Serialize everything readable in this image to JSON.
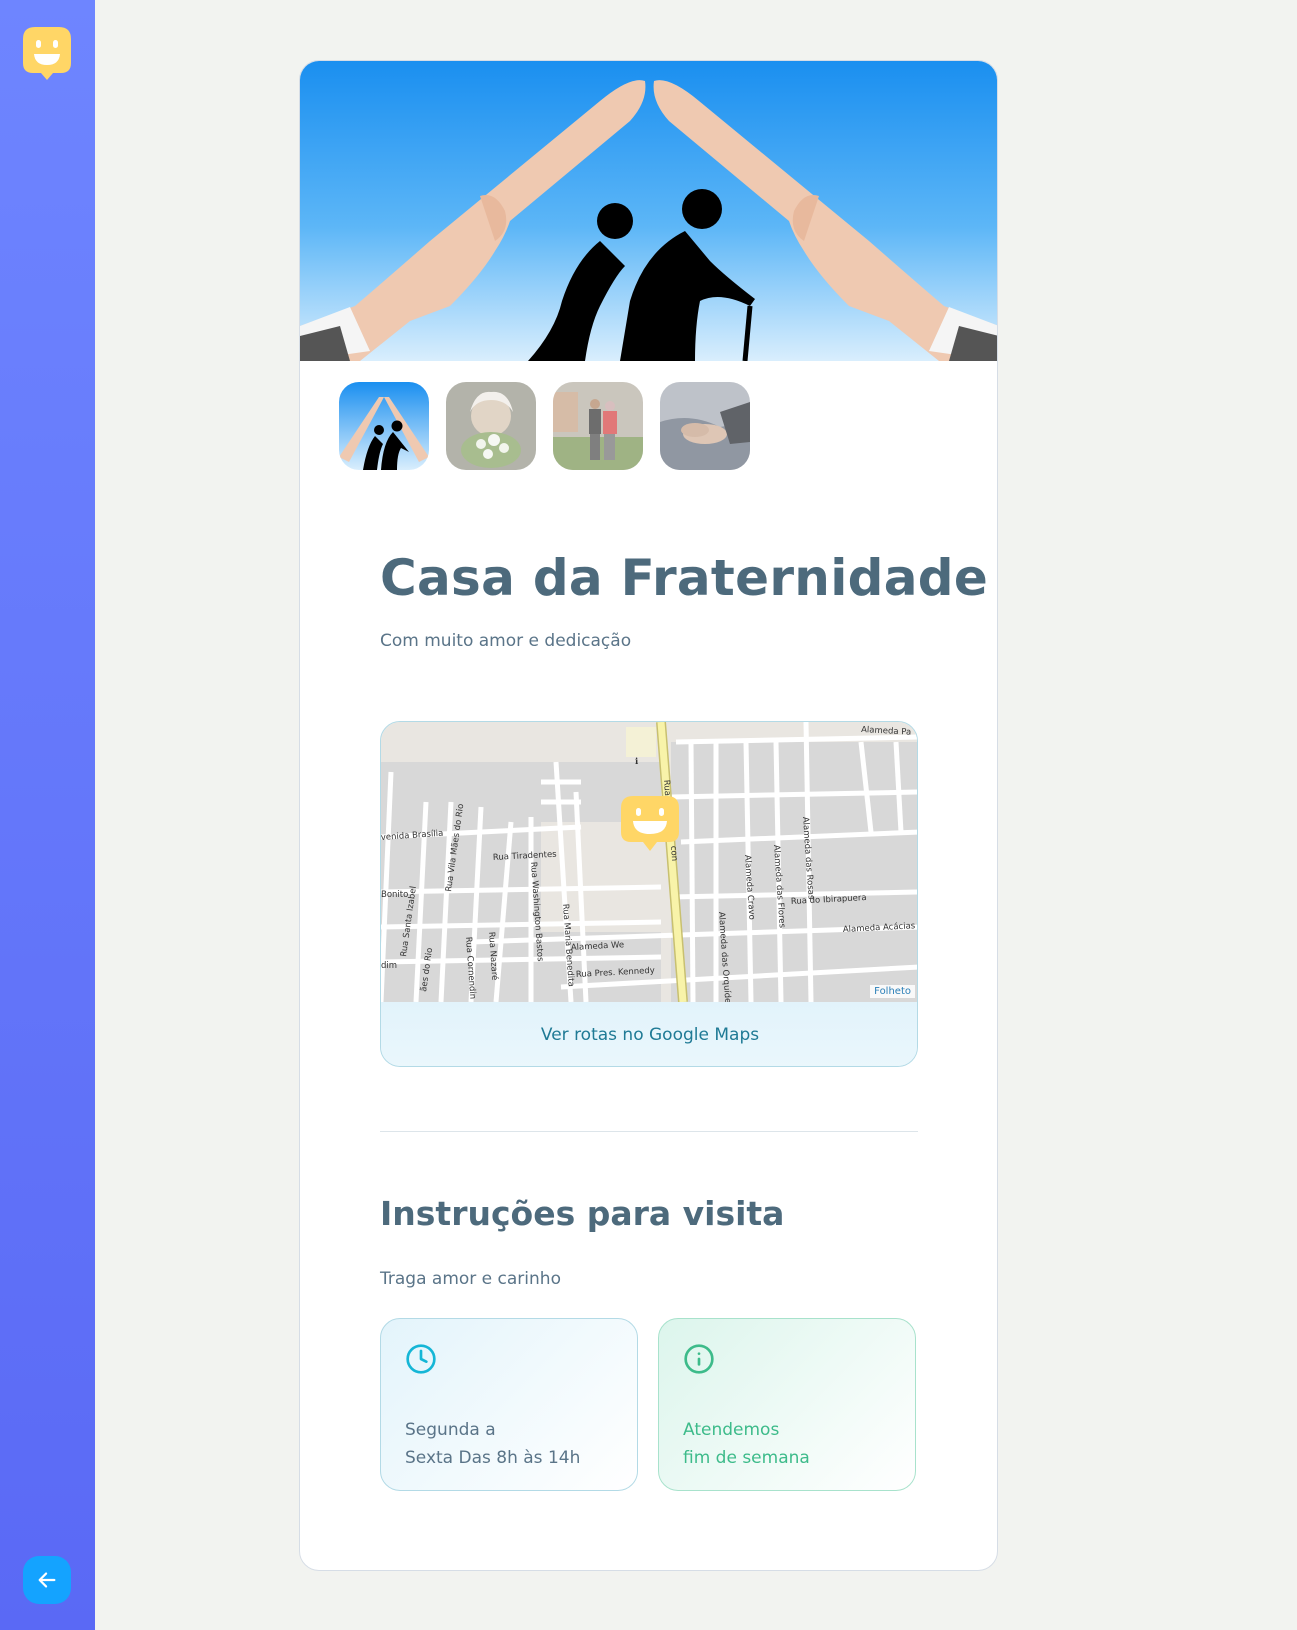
{
  "place": {
    "title": "Casa da Fraternidade",
    "subtitle": "Com muito amor e dedicação"
  },
  "gallery": {
    "thumbnails": [
      "hands-house-elderly",
      "elderly-woman-flowers",
      "elderly-couple-walking",
      "holding-hands"
    ],
    "active_index": 0
  },
  "map": {
    "link_label": "Ver rotas no Google Maps",
    "attribution": "Folheto",
    "street_labels": [
      "Alameda Pa",
      "venida Brasília",
      "Rua Vila Mães do Rio",
      "Rua Tiradentes",
      "Bonito",
      "Rua Santa Izabel",
      "Rua Washington Bastos",
      "Rua Maria Benedita",
      "Alameda We",
      "Rua Pres. Kennedy",
      "dim",
      "ães do Rio",
      "Rua Cornendin",
      "Rua Nazaré",
      "Alameda Cravo",
      "Alameda das Flores",
      "Alameda das Rosas",
      "Rua do Ibirapuera",
      "Alameda Acácias",
      "Alameda das Orquíde",
      "Rua",
      "con"
    ]
  },
  "instructions": {
    "heading": "Instruções para visita",
    "subtitle": "Traga amor e carinho",
    "hours": {
      "line1": "Segunda a",
      "line2": "Sexta Das 8h às 14h",
      "icon": "clock-icon"
    },
    "weekend": {
      "line1": "Atendemos",
      "line2": "fim de semana",
      "icon": "info-icon"
    }
  },
  "colors": {
    "sidebar_top": "#6e85ff",
    "sidebar_bottom": "#5a69f5",
    "logo_yellow": "#ffd666",
    "back_button": "#14a3ff",
    "title_text": "#4d6a7c",
    "green_text": "#3dbb8a",
    "blue_icon": "#15b6d6"
  }
}
